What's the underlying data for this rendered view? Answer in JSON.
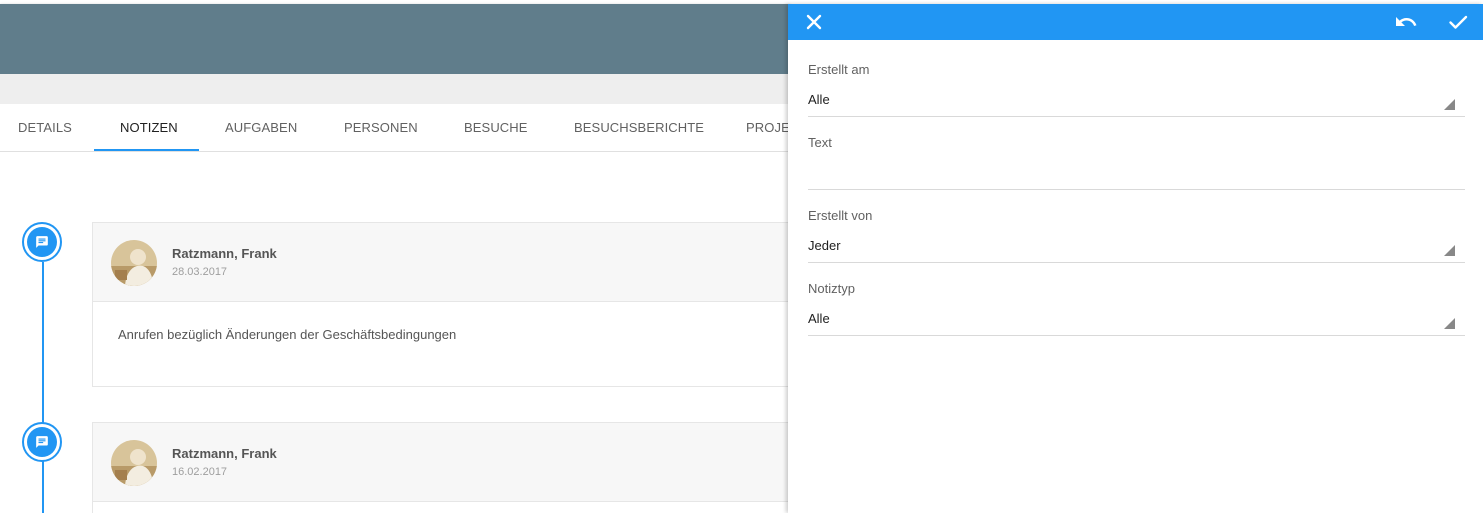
{
  "tabs": [
    {
      "label": "DETAILS"
    },
    {
      "label": "NOTIZEN"
    },
    {
      "label": "AUFGABEN"
    },
    {
      "label": "PERSONEN"
    },
    {
      "label": "BESUCHE"
    },
    {
      "label": "BESUCHSBERICHTE"
    },
    {
      "label": "PROJE"
    }
  ],
  "active_tab": "NOTIZEN",
  "notes": [
    {
      "author": "Ratzmann, Frank",
      "date": "28.03.2017",
      "text": "Anrufen bezüglich Änderungen der Geschäftsbedingungen",
      "icon": "comment-icon"
    },
    {
      "author": "Ratzmann, Frank",
      "date": "16.02.2017",
      "text": "",
      "icon": "comment-icon"
    }
  ],
  "filter_panel": {
    "icons": {
      "close": "close-icon",
      "undo": "undo-icon",
      "apply": "check-icon"
    },
    "fields": {
      "created_at": {
        "label": "Erstellt am",
        "value": "Alle"
      },
      "text": {
        "label": "Text",
        "value": ""
      },
      "created_by": {
        "label": "Erstellt von",
        "value": "Jeder"
      },
      "note_type": {
        "label": "Notiztyp",
        "value": "Alle"
      }
    }
  },
  "colors": {
    "header": "#607d8b",
    "accent": "#2196f3",
    "sub_band": "#eeeeee"
  }
}
